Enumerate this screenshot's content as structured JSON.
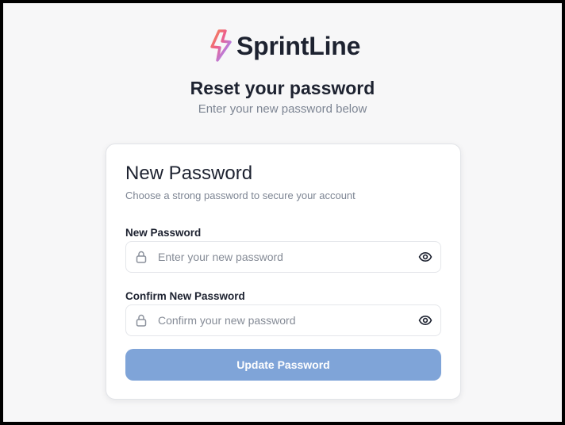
{
  "brand": {
    "name": "SprintLine",
    "logo_icon": "lightning-bolt-icon",
    "logo_gradient": [
      "#f58b4d",
      "#ee5f8a",
      "#b57fe3",
      "#7a8ff0"
    ]
  },
  "header": {
    "title": "Reset your password",
    "subtitle": "Enter your new password below"
  },
  "card": {
    "title": "New Password",
    "description": "Choose a strong password to secure your account",
    "fields": [
      {
        "label": "New Password",
        "placeholder": "Enter your new password",
        "value": "",
        "left_icon": "lock-icon",
        "right_icon": "eye-icon"
      },
      {
        "label": "Confirm New Password",
        "placeholder": "Confirm your new password",
        "value": "",
        "left_icon": "lock-icon",
        "right_icon": "eye-icon"
      }
    ],
    "submit_label": "Update Password",
    "submit_color": "#7fa4d8"
  }
}
